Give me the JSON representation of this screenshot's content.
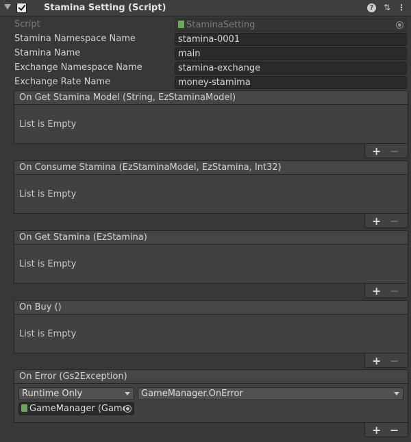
{
  "component": {
    "title": "Stamina Setting (Script)",
    "icons": [
      "foldout-arrow-icon",
      "enabled-checkbox",
      "help-icon",
      "preset-icon",
      "more-menu-icon"
    ]
  },
  "fields": {
    "script": {
      "label": "Script",
      "value": "StaminaSetting"
    },
    "stamina_namespace": {
      "label": "Stamina Namespace Name",
      "value": "stamina-0001"
    },
    "stamina_name": {
      "label": "Stamina Name",
      "value": "main"
    },
    "exchange_namespace": {
      "label": "Exchange Namespace Name",
      "value": "stamina-exchange"
    },
    "exchange_rate": {
      "label": "Exchange Rate Name",
      "value": "money-stamima"
    }
  },
  "events": [
    {
      "title": "On Get Stamina Model (String, EzStaminaModel)",
      "empty": "List is Empty"
    },
    {
      "title": "On Consume Stamina (EzStaminaModel, EzStamina, Int32)",
      "empty": "List is Empty"
    },
    {
      "title": "On Get Stamina (EzStamina)",
      "empty": "List is Empty"
    },
    {
      "title": "On Buy ()",
      "empty": "List is Empty"
    },
    {
      "title": "On Error (Gs2Exception)",
      "empty": ""
    }
  ],
  "on_error_listener": {
    "mode": "Runtime Only",
    "function": "GameManager.OnError",
    "target": "GameManager (Game"
  },
  "list_buttons": {
    "add": "+",
    "remove": "−"
  },
  "header_glyphs": {
    "help": "?",
    "preset": "⇅",
    "more": "⋮"
  }
}
